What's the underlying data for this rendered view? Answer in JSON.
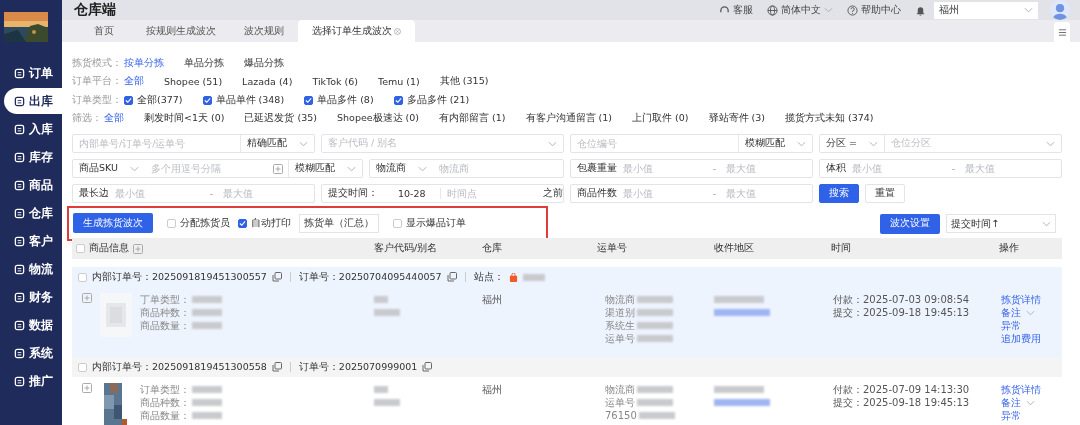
{
  "sidebar": {
    "items": [
      {
        "label": "订单",
        "selected": false
      },
      {
        "label": "出库",
        "selected": true
      },
      {
        "label": "入库",
        "selected": false
      },
      {
        "label": "库存",
        "selected": false
      },
      {
        "label": "商品",
        "selected": false
      },
      {
        "label": "仓库",
        "selected": false
      },
      {
        "label": "客户",
        "selected": false
      },
      {
        "label": "物流",
        "selected": false
      },
      {
        "label": "财务",
        "selected": false
      },
      {
        "label": "数据",
        "selected": false
      },
      {
        "label": "系统",
        "selected": false
      },
      {
        "label": "推广",
        "selected": false
      }
    ]
  },
  "header": {
    "title": "仓库端",
    "links": [
      {
        "kind": "headset",
        "label": "客服",
        "dropdown": false
      },
      {
        "kind": "globe",
        "label": "简体中文",
        "dropdown": true
      },
      {
        "kind": "help",
        "label": "帮助中心",
        "dropdown": false
      }
    ],
    "warehouse": "福州"
  },
  "tabs": [
    {
      "label": "首页",
      "selected": false
    },
    {
      "label": "按规则生成波次",
      "selected": false
    },
    {
      "label": "波次规则",
      "selected": false
    },
    {
      "label": "选择订单生成波次",
      "selected": true
    }
  ],
  "filters": [
    {
      "label": "拣货模式：",
      "kind": "link",
      "options": [
        {
          "label": "按单分拣",
          "selected": true
        },
        {
          "label": "单品分拣",
          "selected": false
        },
        {
          "label": "爆品分拣",
          "selected": false
        }
      ]
    },
    {
      "label": "订单平台：",
      "kind": "link",
      "options": [
        {
          "label": "全部",
          "selected": true
        },
        {
          "label": "Shopee (51)",
          "selected": false
        },
        {
          "label": "Lazada (4)",
          "selected": false
        },
        {
          "label": "TikTok (6)",
          "selected": false
        },
        {
          "label": "Temu (1)",
          "selected": false
        },
        {
          "label": "其他 (315)",
          "selected": false
        }
      ]
    },
    {
      "label": "订单类型：",
      "kind": "checkbox",
      "options": [
        {
          "label": "全部(377)",
          "checked": true
        },
        {
          "label": "单品单件 (348)",
          "checked": true
        },
        {
          "label": "单品多件 (8)",
          "checked": true
        },
        {
          "label": "多品多件 (21)",
          "checked": true
        }
      ]
    },
    {
      "label": "筛选：",
      "kind": "link",
      "options": [
        {
          "label": "全部",
          "selected": true
        },
        {
          "label": "剩发时间<1天 (0)",
          "selected": false
        },
        {
          "label": "已延迟发货 (35)",
          "selected": false
        },
        {
          "label": "Shopee极速达 (0)",
          "selected": false
        },
        {
          "label": "有内部留言 (1)",
          "selected": false
        },
        {
          "label": "有客户沟通留言 (1)",
          "selected": false
        },
        {
          "label": "上门取件 (0)",
          "selected": false
        },
        {
          "label": "驿站寄件 (3)",
          "selected": false
        },
        {
          "label": "揽货方式未知 (374)",
          "selected": false
        }
      ]
    }
  ],
  "search_rows": [
    [
      {
        "boxes": [
          [
            {
              "kind": "input",
              "placeholder": "内部单号/订单号/运单号"
            },
            {
              "kind": "select",
              "value": "精确匹配"
            }
          ]
        ]
      },
      {
        "boxes": [
          [
            {
              "kind": "select",
              "placeholder": "客户代码 / 别名"
            }
          ]
        ]
      },
      {
        "boxes": [
          [
            {
              "kind": "input",
              "placeholder": "仓位编号"
            },
            {
              "kind": "select",
              "value": "模糊匹配"
            }
          ]
        ]
      },
      {
        "boxes": [
          [
            {
              "kind": "select",
              "value": "分区 ="
            },
            {
              "kind": "select",
              "placeholder": "仓位分区"
            }
          ]
        ]
      }
    ],
    [
      {
        "boxes": [
          [
            {
              "kind": "select",
              "value": "商品SKU"
            },
            {
              "kind": "input",
              "placeholder": "多个用逗号分隔",
              "expand": true
            },
            {
              "kind": "select",
              "value": "模糊匹配"
            }
          ],
          [
            {
              "kind": "select",
              "value": "物流商"
            },
            {
              "kind": "input",
              "placeholder": "物流商"
            }
          ]
        ]
      },
      {
        "boxes": [
          [
            {
              "kind": "label",
              "text": "包裹重量"
            },
            {
              "kind": "input",
              "placeholder": "最小值"
            },
            {
              "kind": "dash",
              "text": "-"
            },
            {
              "kind": "input",
              "placeholder": "最大值"
            }
          ]
        ]
      },
      {
        "boxes": [
          [
            {
              "kind": "label",
              "text": "体积"
            },
            {
              "kind": "input",
              "placeholder": "最小值"
            },
            {
              "kind": "dash",
              "text": "-"
            },
            {
              "kind": "input",
              "placeholder": "最大值"
            }
          ]
        ]
      }
    ],
    [
      {
        "boxes": [
          [
            {
              "kind": "label",
              "text": "最长边"
            },
            {
              "kind": "input",
              "placeholder": "最小值"
            },
            {
              "kind": "dash",
              "text": "-"
            },
            {
              "kind": "input",
              "placeholder": "最大值"
            }
          ]
        ]
      },
      {
        "boxes": [
          [
            {
              "kind": "label",
              "text": "提交时间："
            },
            {
              "kind": "value",
              "text": "10-28"
            },
            {
              "kind": "input",
              "placeholder": "时间点"
            },
            {
              "kind": "label",
              "text": "之前"
            }
          ]
        ]
      },
      {
        "boxes": [
          [
            {
              "kind": "label",
              "text": "商品件数"
            },
            {
              "kind": "input",
              "placeholder": "最小值"
            },
            {
              "kind": "dash",
              "text": "-"
            },
            {
              "kind": "input",
              "placeholder": "最大值"
            }
          ]
        ]
      },
      {
        "buttons": [
          {
            "label": "搜索",
            "primary": true
          },
          {
            "label": "重置",
            "primary": false
          }
        ]
      }
    ]
  ],
  "action_bar": {
    "highlighted": true,
    "left": [
      {
        "kind": "button",
        "label": "生成拣货波次"
      },
      {
        "kind": "checkbox",
        "label": "分配拣货员",
        "checked": false
      },
      {
        "kind": "checkbox",
        "label": "自动打印",
        "checked": true
      },
      {
        "kind": "select",
        "value": "拣货单（汇总）"
      },
      {
        "kind": "checkbox",
        "label": "显示爆品订单",
        "checked": false
      }
    ],
    "right": [
      {
        "kind": "button",
        "label": "波次设置"
      },
      {
        "kind": "select",
        "value": "提交时间↑"
      }
    ]
  },
  "table": {
    "all_checked": false,
    "columns": [
      "商品信息",
      "客户代码/别名",
      "仓库",
      "运单号",
      "收件地区",
      "时间",
      "操作"
    ],
    "orders": [
      {
        "highlighted": true,
        "internal_no_label": "内部订单号：",
        "internal_no": "2025091819451300557",
        "order_no_label": "订单号：",
        "order_no": "20250704095440057",
        "site_label": "站点：",
        "product_labels": [
          "丁单类型：",
          "商品种数：",
          "商品数量："
        ],
        "warehouse": "福州",
        "shipping_labels": [
          "物流商",
          "渠道别",
          "系统生",
          "运单号"
        ],
        "times": [
          {
            "label": "付款：",
            "value": "2025-07-03 09:08:54"
          },
          {
            "label": "提交：",
            "value": "2025-09-18 19:45:13"
          }
        ],
        "actions": [
          {
            "label": "拣货详情",
            "dropdown": false
          },
          {
            "label": "备注",
            "dropdown": true
          },
          {
            "label": "异常",
            "dropdown": false
          },
          {
            "label": "追加费用",
            "dropdown": false
          }
        ]
      },
      {
        "highlighted": false,
        "internal_no_label": "内部订单号：",
        "internal_no": "2025091819451300558",
        "order_no_label": "订单号：",
        "order_no": "2025070999001",
        "product_labels": [
          "订单类型：",
          "商品种数：",
          "商品数量："
        ],
        "warehouse": "福州",
        "shipping_labels": [
          "物流商",
          "运单号",
          "76150"
        ],
        "times": [
          {
            "label": "付款：",
            "value": "2025-07-09 14:13:30"
          },
          {
            "label": "提交：",
            "value": "2025-09-18 19:45:13"
          }
        ],
        "actions": [
          {
            "label": "拣货详情",
            "dropdown": false
          },
          {
            "label": "备注",
            "dropdown": true
          },
          {
            "label": "异常",
            "dropdown": false
          }
        ]
      }
    ]
  }
}
